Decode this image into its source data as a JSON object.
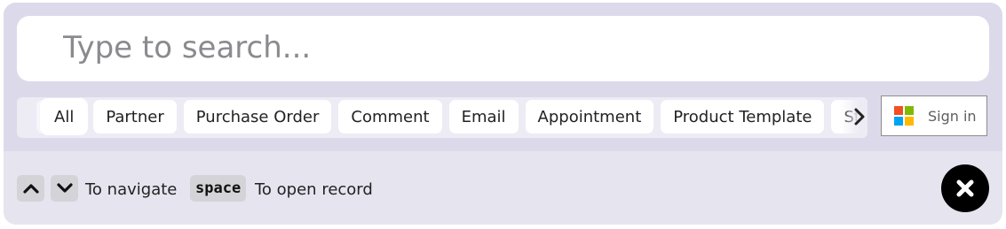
{
  "search": {
    "placeholder": "Type to search...",
    "value": ""
  },
  "tabs": [
    {
      "label": "All",
      "active": true
    },
    {
      "label": "Partner"
    },
    {
      "label": "Purchase Order"
    },
    {
      "label": "Comment"
    },
    {
      "label": "Email"
    },
    {
      "label": "Appointment"
    },
    {
      "label": "Product Template"
    },
    {
      "label": "Stock"
    }
  ],
  "signin": {
    "label": "Sign in",
    "icon": "microsoft-logo-icon"
  },
  "footer": {
    "up_key_icon": "chevron-up-icon",
    "down_key_icon": "chevron-down-icon",
    "navigate_hint": "To navigate",
    "space_key": "space",
    "open_hint": "To open record"
  },
  "close": {
    "icon": "close-icon"
  },
  "colors": {
    "panel_bg": "#e6e4ef",
    "top_zone_bg": "#dcd9ea",
    "tab_bg": "#ffffff",
    "close_bg": "#000000",
    "ms_red": "#f25022",
    "ms_green": "#7fba00",
    "ms_blue": "#00a4ef",
    "ms_yellow": "#ffb900"
  }
}
